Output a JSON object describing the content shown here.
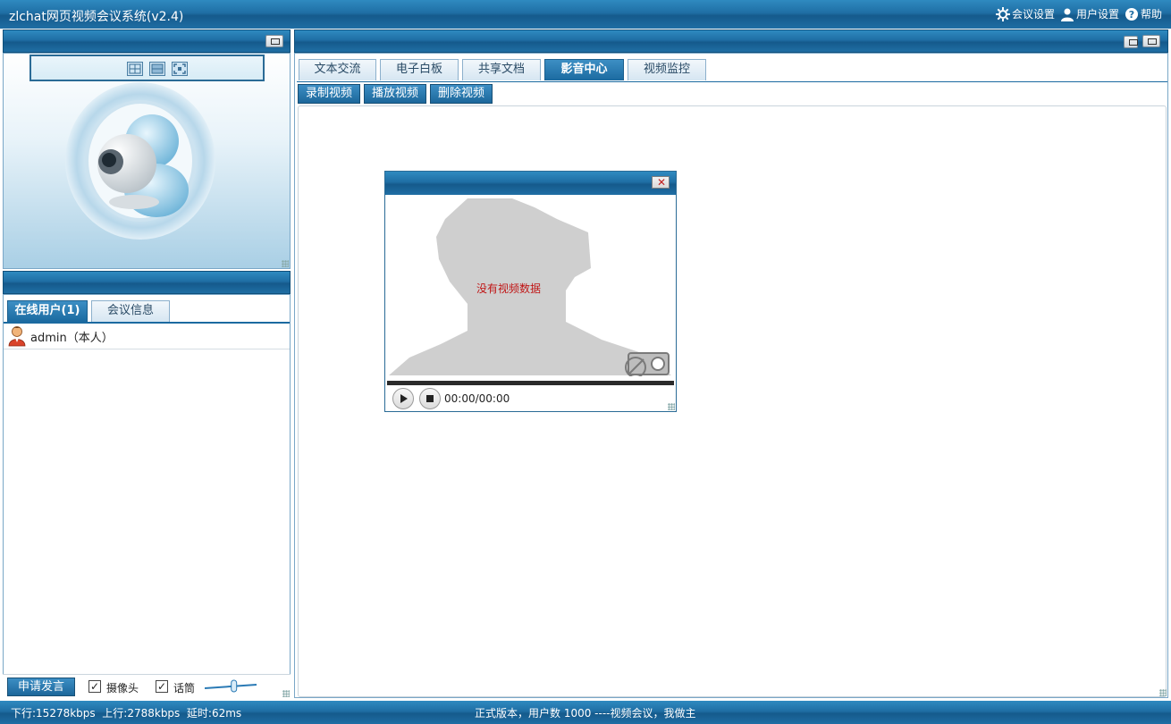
{
  "app": {
    "title": "zlchat网页视频会议系统(v2.4)",
    "menu": [
      {
        "label": "会议设置",
        "icon": "gear-icon"
      },
      {
        "label": "用户设置",
        "icon": "user-icon"
      },
      {
        "label": "帮助",
        "icon": "help-icon"
      }
    ]
  },
  "left": {
    "video_panel": {
      "layout_icons": [
        "grid-layout-icon",
        "single-layout-icon",
        "fullscreen-icon"
      ],
      "placeholder": "webcam-icon"
    },
    "tabs": [
      {
        "label": "在线用户(1)",
        "active": true
      },
      {
        "label": "会议信息",
        "active": false
      }
    ],
    "users": [
      {
        "name": "admin（本人）",
        "icon": "user-avatar-icon"
      }
    ],
    "controls": {
      "apply_label": "申请发言",
      "camera_label": "摄像头",
      "camera_checked": true,
      "mic_label": "话筒",
      "mic_checked": true,
      "volume_level": 0.55
    }
  },
  "right": {
    "tabs": [
      {
        "label": "文本交流",
        "active": false
      },
      {
        "label": "电子白板",
        "active": false
      },
      {
        "label": "共享文档",
        "active": false
      },
      {
        "label": "影音中心",
        "active": true
      },
      {
        "label": "视频监控",
        "active": false
      }
    ],
    "toolbar": [
      "录制视频",
      "播放视频",
      "删除视频"
    ]
  },
  "video_window": {
    "no_data_text": "没有视频数据",
    "time": "00:00/00:00",
    "progress": 0
  },
  "status": {
    "left": "下行:15278kbps  上行:2788kbps  延时:62ms",
    "center": "正式版本，用户数 1000 ----视频会议，我做主"
  },
  "colors": {
    "bar_dark": "#155a8c",
    "bar_light": "#2f8ac0",
    "active_tab": "#1b6aa0",
    "no_data": "#c01515"
  }
}
